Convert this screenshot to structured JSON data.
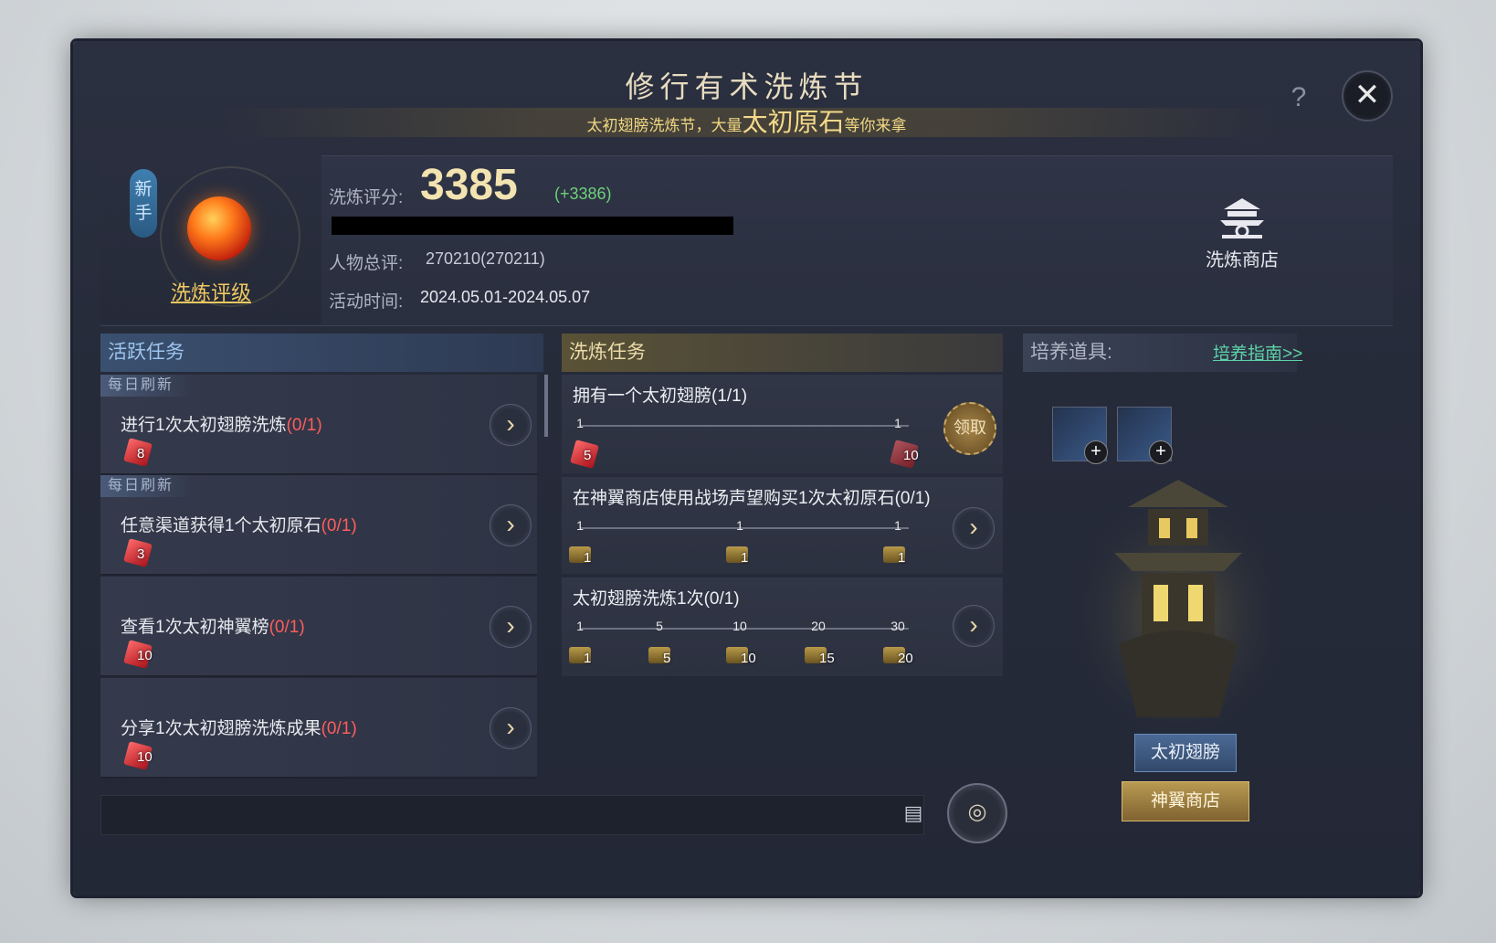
{
  "header": {
    "title": "修行有术洗炼节",
    "subtitle_pre": "太初翅膀洗炼节，大量",
    "subtitle_big": "太初原石",
    "subtitle_post": "等你来拿",
    "help": "?",
    "close": "✕"
  },
  "rank": {
    "badge": "新手",
    "link": "洗炼评级"
  },
  "stats": {
    "score_label": "洗炼评分:",
    "score": "3385",
    "score_delta": "(+3386)",
    "total_label": "人物总评:",
    "total": "270210(270211)",
    "time_label": "活动时间:",
    "time": "2024.05.01-2024.05.07"
  },
  "shop": {
    "label": "洗炼商店"
  },
  "active": {
    "header": "活跃任务",
    "refresh_tag": "每日刷新",
    "tasks": [
      {
        "text": "进行1次太初翅膀洗炼",
        "progress": "(0/1)",
        "reward": "8"
      },
      {
        "text": "任意渠道获得1个太初原石",
        "progress": "(0/1)",
        "reward": "3"
      },
      {
        "text": "查看1次太初神翼榜",
        "progress": "(0/1)",
        "reward": "10"
      },
      {
        "text": "分享1次太初翅膀洗炼成果",
        "progress": "(0/1)",
        "reward": "10"
      }
    ]
  },
  "wash": {
    "header": "洗炼任务",
    "tasks": [
      {
        "title": "拥有一个太初翅膀(1/1)",
        "ticks": [
          "1",
          "1"
        ],
        "rewards": [
          "5",
          "10"
        ],
        "claim": "领取"
      },
      {
        "title": "在神翼商店使用战场声望购买1次太初原石(0/1)",
        "ticks": [
          "1",
          "1",
          "1"
        ],
        "rewards": [
          "1",
          "1",
          "1"
        ]
      },
      {
        "title": "太初翅膀洗炼1次(0/1)",
        "ticks": [
          "1",
          "5",
          "10",
          "20",
          "30"
        ],
        "rewards": [
          "1",
          "5",
          "10",
          "15",
          "20"
        ]
      }
    ]
  },
  "right": {
    "header": "培养道具:",
    "guide": "培养道具:",
    "guide_link": "培养指南>>",
    "btn_wing": "太初翅膀",
    "btn_shop": "神翼商店"
  },
  "colors": {
    "accent_gold": "#f0c860",
    "progress_red": "#ff5d5d",
    "link_green": "#5ed2a8"
  }
}
